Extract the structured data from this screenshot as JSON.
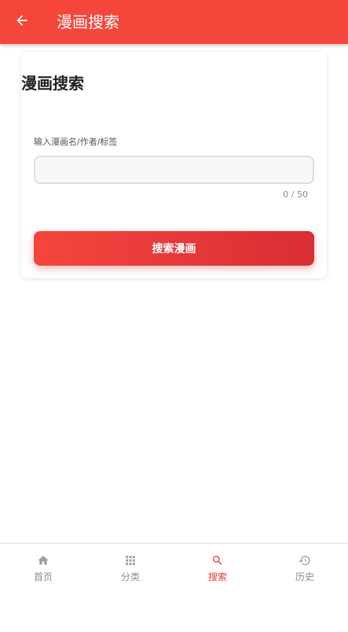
{
  "app_bar": {
    "title": "漫画搜索",
    "back_icon": "arrow-left-icon",
    "background": "#f5463c"
  },
  "search_card": {
    "title": "漫画搜索",
    "input_label": "输入漫画名/作者/标签",
    "input_value": "",
    "input_placeholder": "",
    "counter": "0 / 50",
    "button_label": "搜索漫画"
  },
  "bottom_nav": {
    "active_color": "#e53935",
    "inactive_color": "#8c8c8c",
    "items": [
      {
        "label": "首页",
        "icon": "home-icon",
        "active": false
      },
      {
        "label": "分类",
        "icon": "grid-icon",
        "active": false
      },
      {
        "label": "搜索",
        "icon": "search-icon",
        "active": true
      },
      {
        "label": "历史",
        "icon": "history-icon",
        "active": false
      }
    ]
  }
}
